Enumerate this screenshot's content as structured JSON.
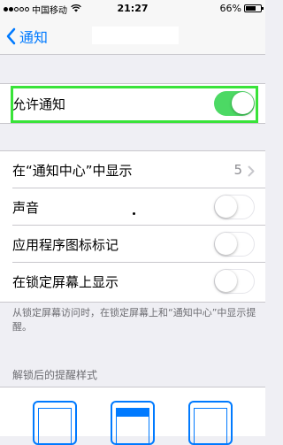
{
  "status_bar": {
    "carrier": "中国移动",
    "time": "21:27",
    "battery_percent": "66%",
    "battery_level": 0.66,
    "signal_bars_filled": 2,
    "signal_bars_total": 5
  },
  "nav": {
    "back_label": "通知"
  },
  "allow_notifications": {
    "label": "允许通知",
    "enabled": true
  },
  "settings": {
    "notification_center": {
      "label": "在“通知中心”中显示",
      "value": "5"
    },
    "sound": {
      "label": "声音",
      "enabled": false
    },
    "badge_app_icon": {
      "label": "应用程序图标标记",
      "enabled": false
    },
    "show_on_lock_screen": {
      "label": "在锁定屏幕上显示",
      "enabled": false
    }
  },
  "lock_screen_footer": "从锁定屏幕访问时，在锁定屏幕上和“通知中心”中显示提醒。",
  "alert_style_header": "解锁后的提醒样式",
  "colors": {
    "accent": "#007aff",
    "toggle_on": "#4cd964",
    "highlight": "#39e339",
    "background": "#efeff4"
  }
}
